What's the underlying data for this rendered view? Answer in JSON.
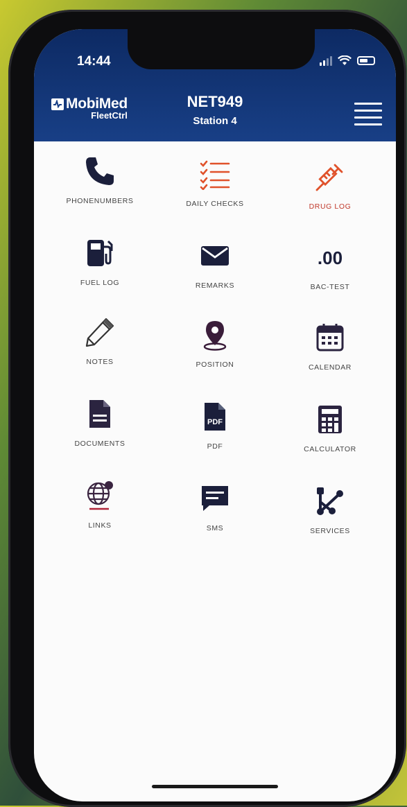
{
  "status_bar": {
    "time": "14:44"
  },
  "header": {
    "logo_main": "MobiMed",
    "logo_sub": "FleetCtrl",
    "device_id": "NET949",
    "station": "Station 4"
  },
  "tiles": [
    {
      "label": "PHONENUMBERS",
      "icon": "phone-icon"
    },
    {
      "label": "DAILY CHECKS",
      "icon": "checklist-icon"
    },
    {
      "label": "DRUG LOG",
      "icon": "syringe-icon"
    },
    {
      "label": "FUEL LOG",
      "icon": "fuel-pump-icon"
    },
    {
      "label": "REMARKS",
      "icon": "envelope-icon"
    },
    {
      "label": "BAC-TEST",
      "icon": "bac-value",
      "value": ".00"
    },
    {
      "label": "NOTES",
      "icon": "pencil-icon"
    },
    {
      "label": "POSITION",
      "icon": "map-pin-icon"
    },
    {
      "label": "CALENDAR",
      "icon": "calendar-icon"
    },
    {
      "label": "DOCUMENTS",
      "icon": "document-icon"
    },
    {
      "label": "PDF",
      "icon": "pdf-icon",
      "icon_text": "PDF"
    },
    {
      "label": "CALCULATOR",
      "icon": "calculator-icon"
    },
    {
      "label": "LINKS",
      "icon": "globe-link-icon"
    },
    {
      "label": "SMS",
      "icon": "chat-icon"
    },
    {
      "label": "SERVICES",
      "icon": "services-icon"
    }
  ],
  "colors": {
    "header": "#183f86",
    "icon_dark": "#1b1f3b",
    "icon_accent": "#e0522b",
    "links_accent": "#b0253a"
  }
}
